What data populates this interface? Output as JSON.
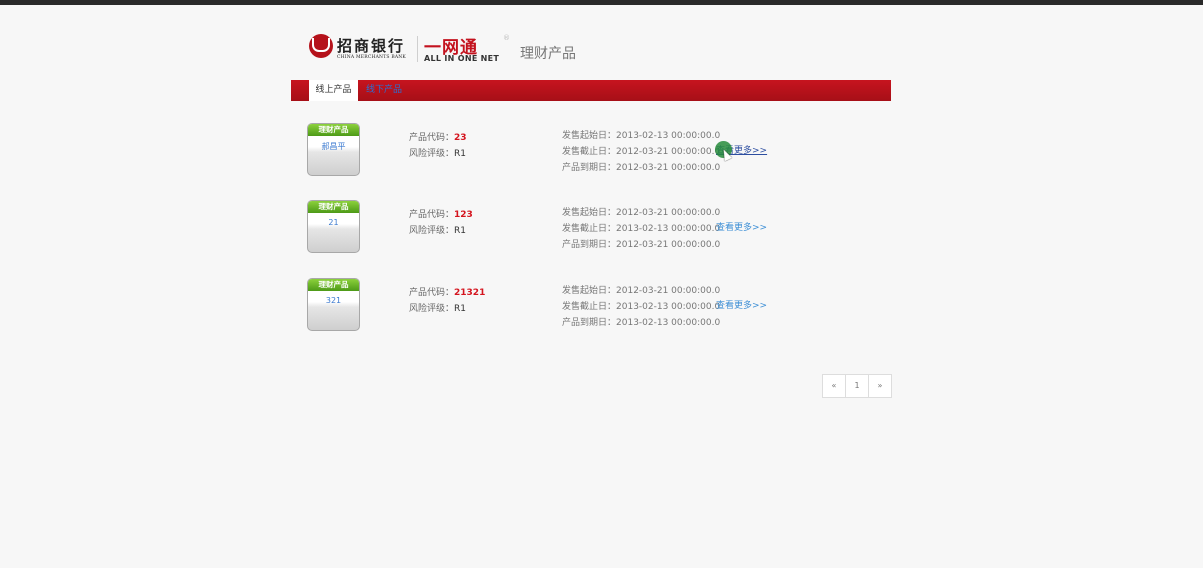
{
  "header": {
    "bank_name": "招商银行",
    "bank_sub": "CHINA MERCHANTS BANK",
    "aio_cn": "一网通",
    "aio_reg": "®",
    "aio_en": "ALL IN ONE NET",
    "title": "理财产品"
  },
  "nav": {
    "tabs": [
      {
        "label": "线上产品",
        "active": true
      },
      {
        "label": "线下产品",
        "active": false
      }
    ]
  },
  "card_header": "理财产品",
  "labels": {
    "code": "产品代码：",
    "risk": "风险评级：",
    "start": "发售起始日：",
    "end": "发售截止日：",
    "maturity": "产品到期日：",
    "more": "查看更多>>"
  },
  "products": [
    {
      "name": "郝昌平",
      "code": "23",
      "risk": "R1",
      "start": "2013-02-13 00:00:00.0",
      "end": "2012-03-21 00:00:00.0",
      "maturity": "2012-03-21 00:00:00.0"
    },
    {
      "name": "21",
      "code": "123",
      "risk": "R1",
      "start": "2012-03-21 00:00:00.0",
      "end": "2013-02-13 00:00:00.0",
      "maturity": "2012-03-21 00:00:00.0"
    },
    {
      "name": "321",
      "code": "21321",
      "risk": "R1",
      "start": "2012-03-21 00:00:00.0",
      "end": "2013-02-13 00:00:00.0",
      "maturity": "2013-02-13 00:00:00.0"
    }
  ],
  "pagination": {
    "prev": "«",
    "page": "1",
    "next": "»"
  },
  "colors": {
    "brand_red": "#c3121e",
    "card_green": "#6bb82a",
    "link_blue": "#3d8fd6"
  }
}
